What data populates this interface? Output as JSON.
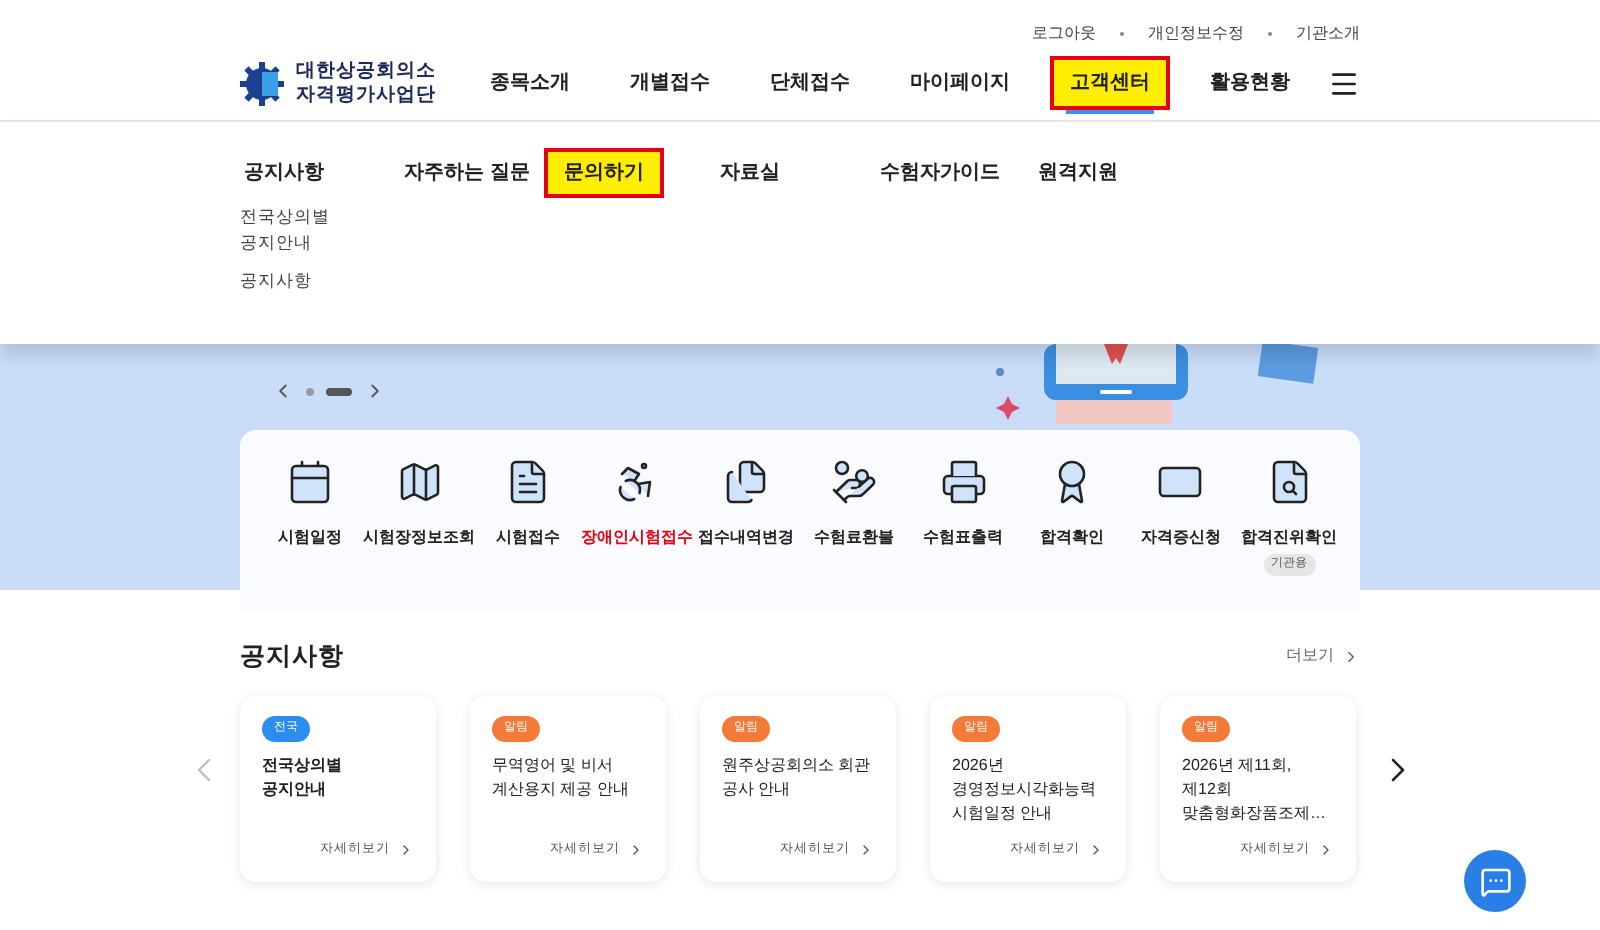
{
  "utility_links": [
    "로그아웃",
    "개인정보수정",
    "기관소개"
  ],
  "logo": {
    "line_1": "대한상공회의소",
    "line_2": "자격평가사업단"
  },
  "nav": [
    {
      "label": "종목소개",
      "selected": false
    },
    {
      "label": "개별접수",
      "selected": false
    },
    {
      "label": "단체접수",
      "selected": false
    },
    {
      "label": "마이페이지",
      "selected": false
    },
    {
      "label": "고객센터",
      "selected": true
    },
    {
      "label": "활용현황",
      "selected": false
    }
  ],
  "submenu": [
    {
      "label": "공지사항",
      "selected": false,
      "children": [
        "전국상의별\n공지안내",
        "공지사항"
      ]
    },
    {
      "label": "자주하는 질문",
      "selected": false
    },
    {
      "label": "문의하기",
      "selected": true
    },
    {
      "label": "자료실",
      "selected": false
    },
    {
      "label": "수험자가이드",
      "selected": false
    },
    {
      "label": "원격지원",
      "selected": false
    }
  ],
  "banner": {
    "dots": [
      {
        "selected": false
      },
      {
        "selected": true
      }
    ]
  },
  "quick_menu": [
    {
      "label": "시험일정",
      "kind": "calendar",
      "highlight": false
    },
    {
      "label": "시험장정보조회",
      "kind": "map",
      "highlight": false
    },
    {
      "label": "시험접수",
      "kind": "document",
      "highlight": false
    },
    {
      "label": "장애인시험접수",
      "kind": "wheelchair",
      "highlight": true
    },
    {
      "label": "접수내역변경",
      "kind": "files",
      "highlight": false
    },
    {
      "label": "수험료환불",
      "kind": "hand",
      "highlight": false
    },
    {
      "label": "수험표출력",
      "kind": "printer",
      "highlight": false
    },
    {
      "label": "합격확인",
      "kind": "certificate",
      "highlight": false
    },
    {
      "label": "자격증신청",
      "kind": "card",
      "highlight": false
    },
    {
      "label": "합격진위확인",
      "kind": "search",
      "highlight": false,
      "badge": "기관용"
    }
  ],
  "notices": {
    "title": "공지사항",
    "more": "더보기",
    "cards": [
      {
        "tag": "전국",
        "color": "#2d8cf0",
        "title": "전국상의별\n공지안내",
        "bold": true,
        "link": "자세히보기"
      },
      {
        "tag": "알림",
        "color": "#f47a3a",
        "title": "무역영어 및 비서\n계산용지 제공 안내",
        "bold": false,
        "link": "자세히보기"
      },
      {
        "tag": "알림",
        "color": "#f47a3a",
        "title": "원주상공회의소 회관\n공사 안내",
        "bold": false,
        "link": "자세히보기"
      },
      {
        "tag": "알림",
        "color": "#f47a3a",
        "title": "2026년\n경영정보시각화능력\n시험일정 안내",
        "bold": false,
        "link": "자세히보기"
      },
      {
        "tag": "알림",
        "color": "#f47a3a",
        "title": "2026년 제11회,\n제12회\n맞춤형화장품조제…",
        "bold": false,
        "link": "자세히보기"
      }
    ]
  }
}
